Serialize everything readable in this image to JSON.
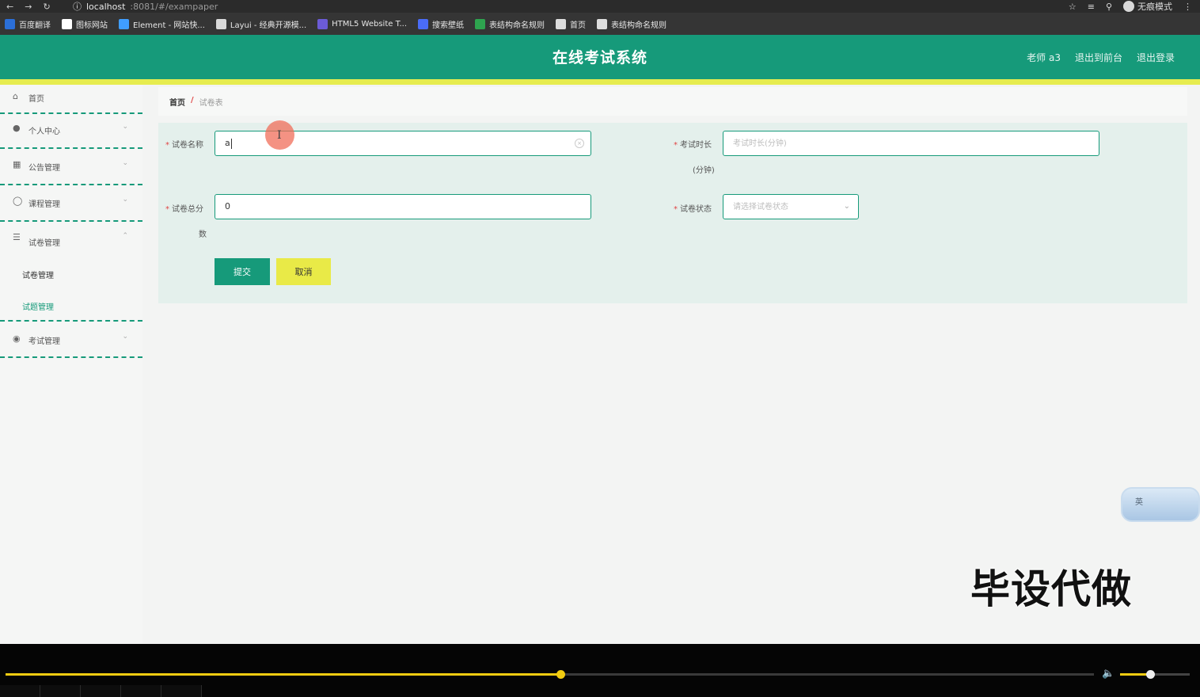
{
  "browser": {
    "url_host": "localhost",
    "url_path": ":8081/#/exampaper",
    "profile_label": "无痕模式"
  },
  "bookmarks": [
    {
      "label": "百度翻译",
      "color": "#2b6fd8"
    },
    {
      "label": "图标网站",
      "color": "#ffffff"
    },
    {
      "label": "Element - 网站快...",
      "color": "#409eff"
    },
    {
      "label": "Layui - 经典开源模...",
      "color": "#d9d9d9"
    },
    {
      "label": "HTML5 Website T...",
      "color": "#6b5bd6"
    },
    {
      "label": "搜索壁纸",
      "color": "#4a6cf7"
    },
    {
      "label": "表结构命名规则",
      "color": "#2ea44f"
    },
    {
      "label": "首页",
      "color": "#dddddd"
    },
    {
      "label": "表结构命名规则",
      "color": "#dddddd"
    }
  ],
  "header": {
    "title": "在线考试系统",
    "user": "老师 a3",
    "to_front": "退出到前台",
    "logout": "退出登录"
  },
  "sidebar": {
    "items": [
      {
        "label": "首页",
        "icon": "home-icon"
      },
      {
        "label": "个人中心",
        "icon": "user-icon"
      },
      {
        "label": "公告管理",
        "icon": "notice-icon"
      },
      {
        "label": "课程管理",
        "icon": "course-icon"
      },
      {
        "label": "试卷管理",
        "icon": "paper-icon"
      },
      {
        "label": "考试管理",
        "icon": "exam-icon"
      }
    ],
    "sub_items": [
      "试卷管理",
      "试题管理"
    ]
  },
  "breadcrumb": {
    "home": "首页",
    "separator": "/",
    "current": "试卷表"
  },
  "form": {
    "name_label": "试卷名称",
    "name_value": "a",
    "duration_label": "考试时长",
    "duration_label_line2": "(分钟)",
    "duration_placeholder": "考试时长(分钟)",
    "score_label": "试卷总分",
    "score_label_line2": "数",
    "score_value": "0",
    "status_label": "试卷状态",
    "status_placeholder": "请选择试卷状态",
    "submit": "提交",
    "cancel": "取消"
  },
  "widget": {
    "text": "英"
  },
  "watermark": "毕设代做",
  "player": {
    "progress": 0.51,
    "volume": 0.43
  }
}
